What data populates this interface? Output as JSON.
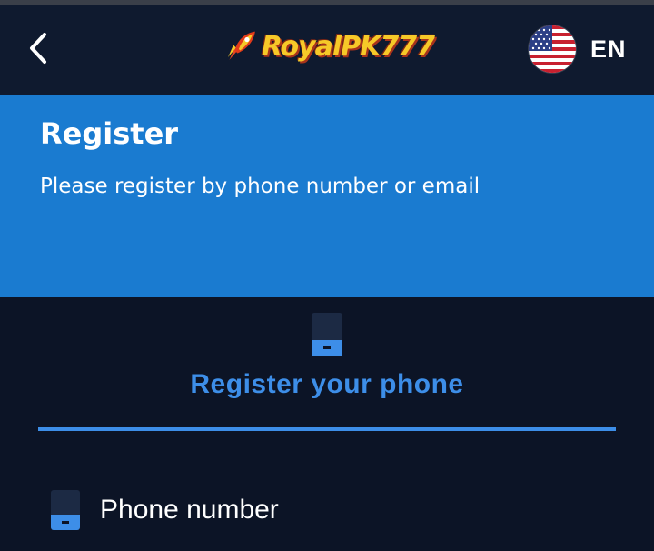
{
  "header": {
    "back_icon": "chevron-left-icon",
    "logo_text": "RoyalPK777",
    "language": {
      "code": "EN",
      "flag_icon": "us-flag-icon"
    }
  },
  "banner": {
    "title": "Register",
    "subtitle": "Please register by phone number or email"
  },
  "tabs": [
    {
      "label": "Register your phone",
      "icon": "phone-icon",
      "active": true
    }
  ],
  "form": {
    "phone_field": {
      "label": "Phone number",
      "icon": "phone-icon"
    }
  },
  "colors": {
    "background": "#0c1426",
    "header": "#0f1a2f",
    "banner": "#1a7bd0",
    "accent": "#3d8ee8",
    "logo_gold": "#f6c928"
  }
}
